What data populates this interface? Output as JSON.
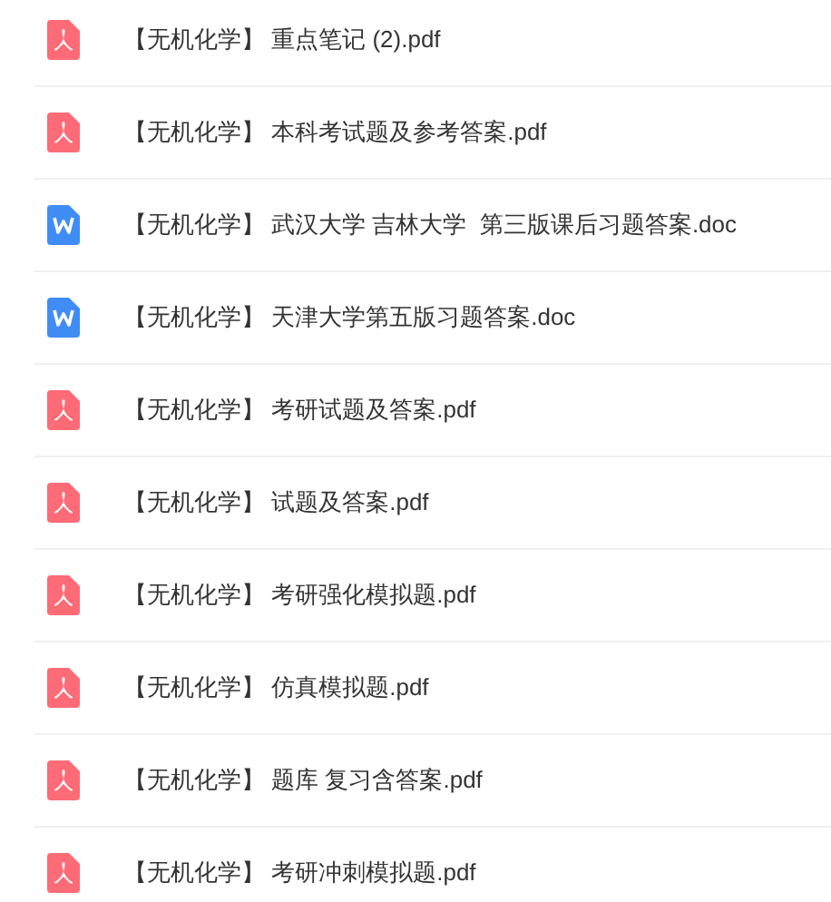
{
  "files": [
    {
      "kind": "pdf",
      "name": "【无机化学】 重点笔记 (2).pdf"
    },
    {
      "kind": "pdf",
      "name": "【无机化学】 本科考试题及参考答案.pdf"
    },
    {
      "kind": "doc",
      "name": "【无机化学】 武汉大学 吉林大学  第三版课后习题答案.doc"
    },
    {
      "kind": "doc",
      "name": "【无机化学】 天津大学第五版习题答案.doc"
    },
    {
      "kind": "pdf",
      "name": "【无机化学】 考研试题及答案.pdf"
    },
    {
      "kind": "pdf",
      "name": "【无机化学】 试题及答案.pdf"
    },
    {
      "kind": "pdf",
      "name": "【无机化学】 考研强化模拟题.pdf"
    },
    {
      "kind": "pdf",
      "name": "【无机化学】 仿真模拟题.pdf"
    },
    {
      "kind": "pdf",
      "name": "【无机化学】 题库 复习含答案.pdf"
    },
    {
      "kind": "pdf",
      "name": "【无机化学】 考研冲刺模拟题.pdf"
    }
  ]
}
